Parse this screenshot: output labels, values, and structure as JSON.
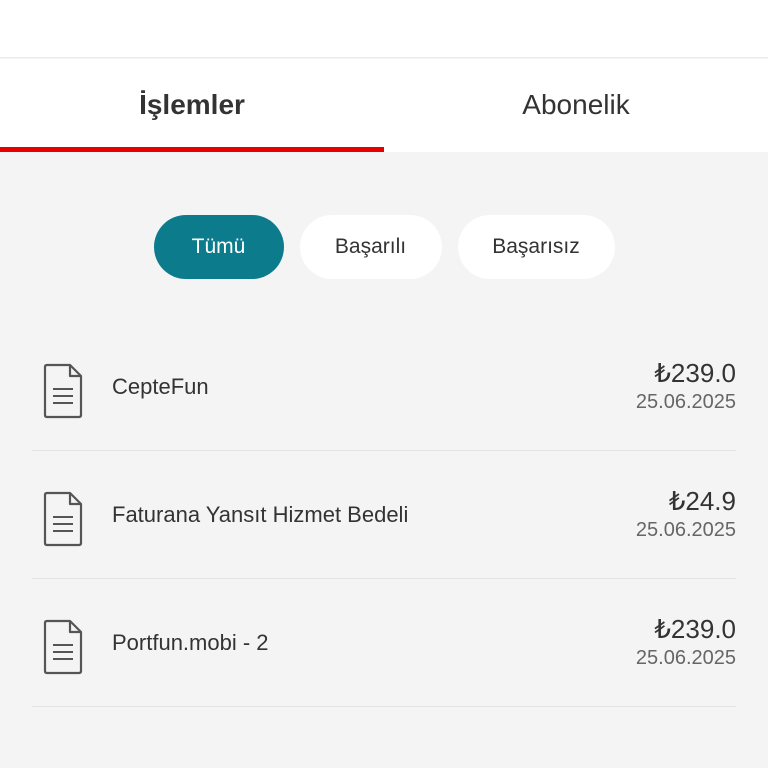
{
  "tabs": [
    {
      "label": "İşlemler",
      "active": true
    },
    {
      "label": "Abonelik",
      "active": false
    }
  ],
  "filters": [
    {
      "label": "Tümü",
      "active": true
    },
    {
      "label": "Başarılı",
      "active": false
    },
    {
      "label": "Başarısız",
      "active": false
    }
  ],
  "transactions": [
    {
      "icon": "document-icon",
      "name": "CepteFun",
      "amount": "₺239.0",
      "date": "25.06.2025"
    },
    {
      "icon": "document-icon",
      "name": "Faturana Yansıt Hizmet Bedeli",
      "amount": "₺24.9",
      "date": "25.06.2025"
    },
    {
      "icon": "document-icon",
      "name": "Portfun.mobi - 2",
      "amount": "₺239.0",
      "date": "25.06.2025"
    }
  ],
  "colors": {
    "accent_red": "#e60000",
    "active_chip": "#0c7c8c",
    "background": "#f4f4f4"
  }
}
